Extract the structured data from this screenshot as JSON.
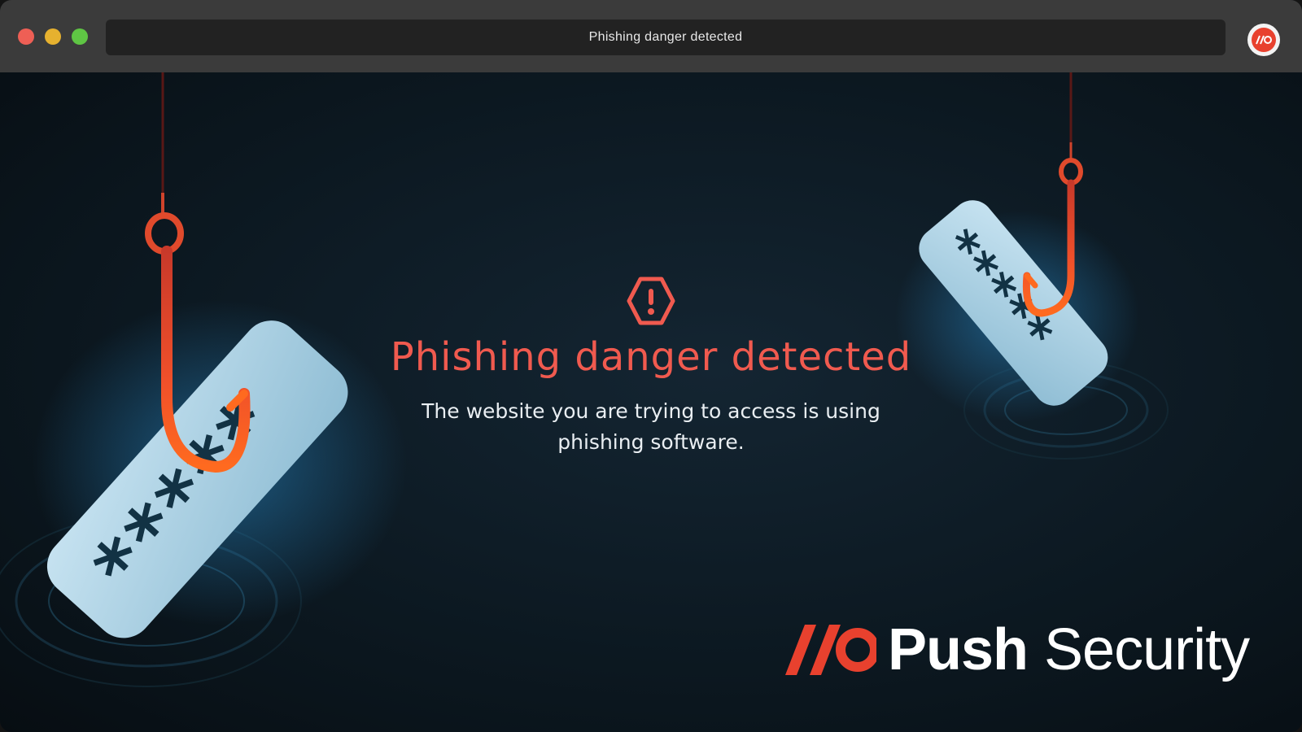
{
  "window": {
    "title": "Phishing danger detected",
    "controls": [
      "close",
      "minimize",
      "maximize"
    ]
  },
  "toolbar": {
    "extension_icon": "push-security-logo-icon"
  },
  "page": {
    "icon": "warning-octagon-icon",
    "headline": "Phishing danger detected",
    "message": "The website you are trying to access is using phishing software.",
    "brand": {
      "mark": "//O",
      "name_bold": "Push",
      "name_light": "Security"
    },
    "illustration": {
      "password_mask_left": "*****",
      "password_mask_right": "*****"
    }
  },
  "colors": {
    "accent": "#f05a4f",
    "brand_red": "#e8412e",
    "background": "#0e1c26",
    "card": "#a9cfe2"
  }
}
